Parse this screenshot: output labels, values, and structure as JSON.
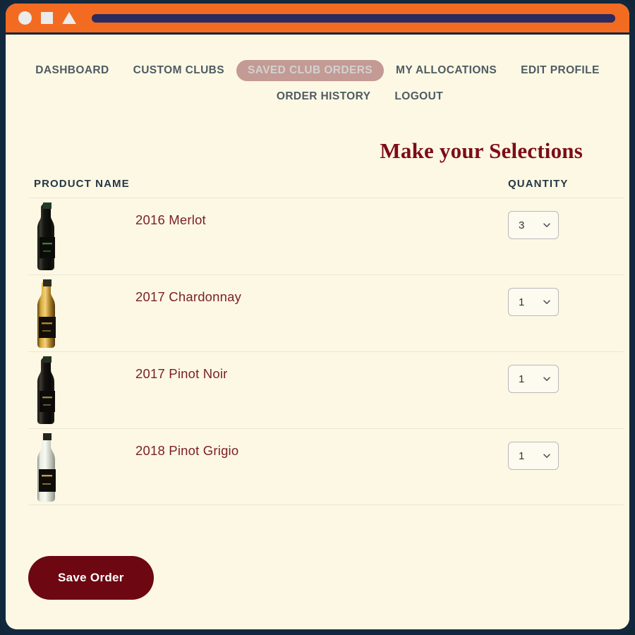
{
  "browser": {
    "controls": [
      "circle-control",
      "square-control",
      "triangle-control"
    ],
    "address_bar_value": ""
  },
  "nav": {
    "row1": [
      {
        "label": "DASHBOARD",
        "active": false
      },
      {
        "label": "CUSTOM CLUBS",
        "active": false
      },
      {
        "label": "SAVED CLUB ORDERS",
        "active": true
      },
      {
        "label": "MY ALLOCATIONS",
        "active": false
      },
      {
        "label": "EDIT PROFILE",
        "active": false
      }
    ],
    "row2": [
      {
        "label": "ORDER HISTORY",
        "active": false
      },
      {
        "label": "LOGOUT",
        "active": false
      }
    ]
  },
  "heading": "Make your Selections",
  "table": {
    "headers": {
      "product": "PRODUCT NAME",
      "quantity": "QUANTITY"
    },
    "rows": [
      {
        "name": "2016 Merlot",
        "quantity": "3",
        "bottle": "red-bottle"
      },
      {
        "name": "2017 Chardonnay",
        "quantity": "1",
        "bottle": "white-gold-bottle"
      },
      {
        "name": "2017 Pinot Noir",
        "quantity": "1",
        "bottle": "red-bottle"
      },
      {
        "name": "2018 Pinot Grigio",
        "quantity": "1",
        "bottle": "clear-bottle"
      }
    ]
  },
  "actions": {
    "save_label": "Save Order"
  },
  "colors": {
    "titlebar": "#f26b21",
    "frame": "#12283c",
    "page_bg": "#fdf8e3",
    "heading": "#7d0c18",
    "product_link": "#7b2128",
    "active_pill": "#c49a94",
    "save_button": "#6d0711",
    "nav_text": "#4e5b64",
    "address_bar": "#2b2b5e"
  }
}
